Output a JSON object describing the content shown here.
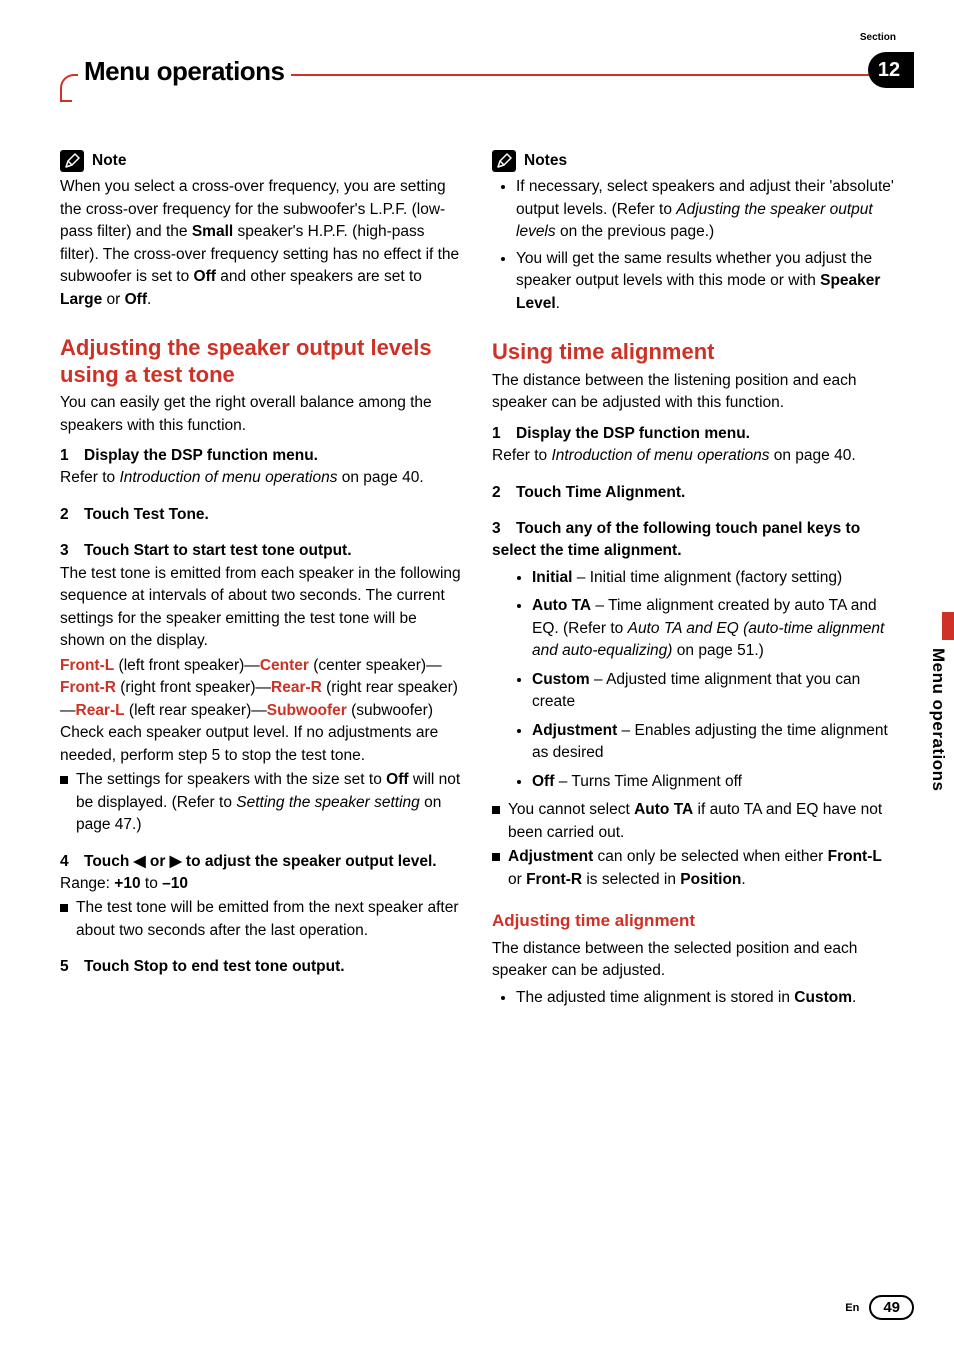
{
  "header": {
    "title": "Menu operations",
    "section_label": "Section",
    "section_number": "12"
  },
  "side_tab": "Menu operations",
  "footer": {
    "lang": "En",
    "page": "49"
  },
  "left": {
    "note_label": "Note",
    "note_body_1": "When you select a cross-over frequency, you are setting the cross-over frequency for the subwoofer's L.P.F. (low-pass filter) and the ",
    "note_body_bold1": "Small",
    "note_body_2": " speaker's H.P.F. (high-pass filter). The cross-over frequency setting has no effect if the subwoofer is set to ",
    "note_body_bold2": "Off",
    "note_body_3": " and other speakers are set to ",
    "note_body_bold3": "Large",
    "note_body_4": " or ",
    "note_body_bold4": "Off",
    "note_body_5": ".",
    "h2": "Adjusting the speaker output levels using a test tone",
    "intro": "You can easily get the right overall balance among the speakers with this function.",
    "s1_title": "Display the DSP function menu.",
    "s1_body_a": "Refer to ",
    "s1_body_ital": "Introduction of menu operations",
    "s1_body_b": " on page 40.",
    "s2_title": "Touch Test Tone.",
    "s3_title": "Touch Start to start test tone output.",
    "s3_body": "The test tone is emitted from each speaker in the following sequence at intervals of about two seconds. The current settings for the speaker emitting the test tone will be shown on the display.",
    "seq_frontl": "Front-L",
    "seq_frontl_desc": " (left front speaker)—",
    "seq_center": "Center",
    "seq_center_desc": " (center speaker)—",
    "seq_frontr": "Front-R",
    "seq_frontr_desc": " (right front speaker)—",
    "seq_rearr": "Rear-R",
    "seq_rearr_desc": " (right rear speaker)—",
    "seq_rearl": "Rear-L",
    "seq_rearl_desc": " (left rear speaker)—",
    "seq_sub": "Subwoofer",
    "seq_sub_desc": " (subwoofer)",
    "s3_body2": "Check each speaker output level. If no adjustments are needed, perform step 5 to stop the test tone.",
    "s3_bullet_a": "The settings for speakers with the size set to ",
    "s3_bullet_bold": "Off",
    "s3_bullet_b": " will not be displayed. (Refer to ",
    "s3_bullet_ital": "Setting the speaker setting",
    "s3_bullet_c": " on page 47.)",
    "s4_title_a": "Touch ",
    "s4_title_b": " or ",
    "s4_title_c": " to adjust the speaker output level.",
    "s4_range_a": "Range: ",
    "s4_range_b": "+10",
    "s4_range_c": " to ",
    "s4_range_d": "–10",
    "s4_bullet": "The test tone will be emitted from the next speaker after about two seconds after the last operation.",
    "s5_title": "Touch Stop to end test tone output."
  },
  "right": {
    "notes_label": "Notes",
    "n1_a": "If necessary, select speakers and adjust their 'absolute' output levels. (Refer to ",
    "n1_ital": "Adjusting the speaker output levels",
    "n1_b": " on the previous page.)",
    "n2_a": "You will get the same results whether you adjust the speaker output levels with this mode or with ",
    "n2_bold": "Speaker Level",
    "n2_b": ".",
    "h2": "Using time alignment",
    "intro": "The distance between the listening position and each speaker can be adjusted with this function.",
    "s1_title": "Display the DSP function menu.",
    "s1_body_a": "Refer to ",
    "s1_body_ital": "Introduction of menu operations",
    "s1_body_b": " on page 40.",
    "s2_title": "Touch Time Alignment.",
    "s3_title": "Touch any of the following touch panel keys to select the time alignment.",
    "opt_initial_b": "Initial",
    "opt_initial_t": " – Initial time alignment (factory setting)",
    "opt_auto_b": "Auto TA",
    "opt_auto_t_a": " – Time alignment created by auto TA and EQ. (Refer to ",
    "opt_auto_ital": "Auto TA and EQ (auto-time alignment and auto-equalizing)",
    "opt_auto_t_b": " on page 51.)",
    "opt_custom_b": "Custom",
    "opt_custom_t": " – Adjusted time alignment that you can create",
    "opt_adj_b": "Adjustment",
    "opt_adj_t": " – Enables adjusting the time alignment as desired",
    "opt_off_b": "Off",
    "opt_off_t": " – Turns Time Alignment off",
    "sq1_a": "You cannot select ",
    "sq1_bold": "Auto TA",
    "sq1_b": " if auto TA and EQ have not been carried out.",
    "sq2_bold1": "Adjustment",
    "sq2_a": " can only be selected when either ",
    "sq2_bold2": "Front-L",
    "sq2_b": " or ",
    "sq2_bold3": "Front-R",
    "sq2_c": " is selected in ",
    "sq2_bold4": "Position",
    "sq2_d": ".",
    "h3": "Adjusting time alignment",
    "adj_intro": "The distance between the selected position and each speaker can be adjusted.",
    "adj_bullet_a": "The adjusted time alignment is stored in ",
    "adj_bullet_bold": "Custom",
    "adj_bullet_b": "."
  }
}
